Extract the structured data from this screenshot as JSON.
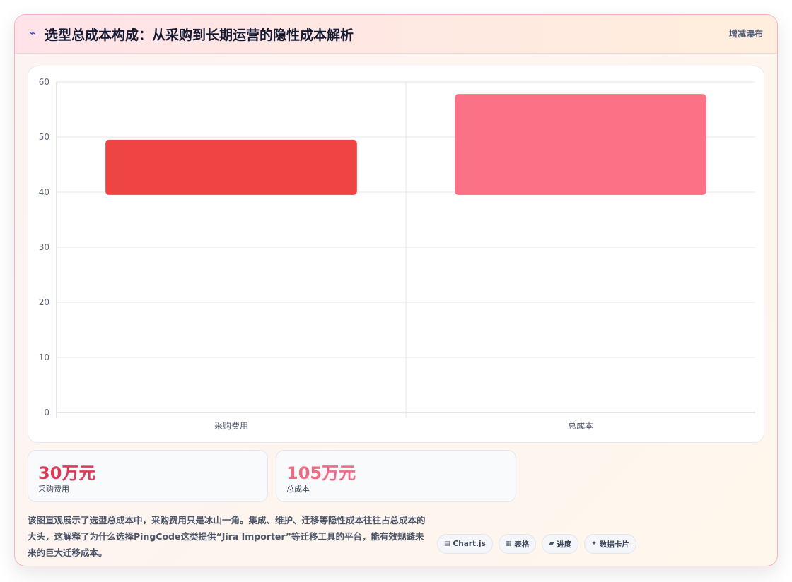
{
  "header": {
    "icon": "lightning-icon",
    "title": "选型总成本构成：从采购到长期运营的隐性成本解析",
    "chart_type_label": "增减瀑布"
  },
  "chart_data": {
    "type": "bar",
    "subtype": "floating-waterfall",
    "title": "",
    "xlabel": "",
    "ylabel": "",
    "categories": [
      "采购费用",
      "总成本"
    ],
    "bars": [
      {
        "category": "采购费用",
        "start": 39.5,
        "end": 49.5,
        "color": "#ef4444"
      },
      {
        "category": "总成本",
        "start": 39.5,
        "end": 57.8,
        "color": "#fb7185"
      }
    ],
    "ylim": [
      0,
      60
    ],
    "yticks": [
      0,
      10,
      20,
      30,
      40,
      50,
      60
    ],
    "grid": true,
    "legend": "none"
  },
  "stats": [
    {
      "value": "30万元",
      "label": "采购费用",
      "color": "#e03a5a"
    },
    {
      "value": "105万元",
      "label": "总成本",
      "color": "#f06985"
    }
  ],
  "description": "该图直观展示了选型总成本中，采购费用只是冰山一角。集成、维护、迁移等隐性成本往往占总成本的大头，这解释了为什么选择PingCode这类提供“Jira Importer”等迁移工具的平台，能有效规避未来的巨大迁移成本。",
  "tags": [
    {
      "icon": "chart-icon",
      "glyph": "▤",
      "label": "Chart.js"
    },
    {
      "icon": "table-icon",
      "glyph": "▦",
      "label": "表格"
    },
    {
      "icon": "progress-icon",
      "glyph": "▰",
      "label": "进度"
    },
    {
      "icon": "sparkle-icon",
      "glyph": "✦",
      "label": "数据卡片"
    }
  ]
}
